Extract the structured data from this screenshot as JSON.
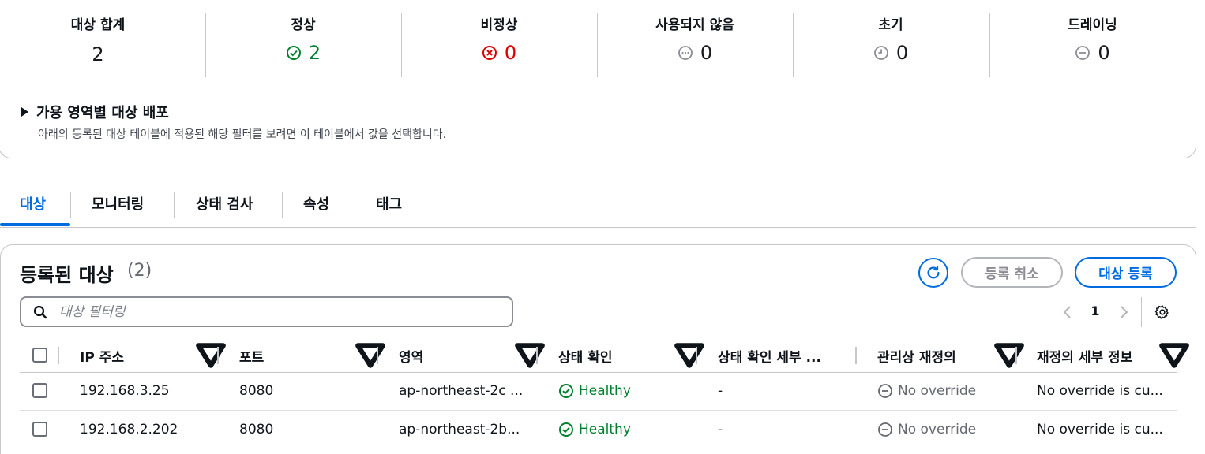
{
  "summary": {
    "stats": [
      {
        "label": "대상 합계",
        "value": "2"
      },
      {
        "label": "정상",
        "value": "2"
      },
      {
        "label": "비정상",
        "value": "0"
      },
      {
        "label": "사용되지 않음",
        "value": "0"
      },
      {
        "label": "초기",
        "value": "0"
      },
      {
        "label": "드레이닝",
        "value": "0"
      }
    ],
    "az_title": "가용 영역별 대상 배포",
    "az_description": "아래의 등록된 대상 테이블에 적용된 해당 필터를 보려면 이 테이블에서 값을 선택합니다."
  },
  "tabs": [
    "대상",
    "모니터링",
    "상태 검사",
    "속성",
    "태그"
  ],
  "targets": {
    "title": "등록된 대상",
    "count": "(2)",
    "deregister_label": "등록 취소",
    "register_label": "대상 등록",
    "search_placeholder": "대상 필터링",
    "page": "1",
    "columns": [
      "IP 주소",
      "포트",
      "영역",
      "상태 확인",
      "상태 확인 세부 ...",
      "관리상 재정의",
      "재정의 세부 정보"
    ],
    "rows": [
      {
        "ip": "192.168.3.25",
        "port": "8080",
        "zone": "ap-northeast-2c ...",
        "health": "Healthy",
        "health_detail": "-",
        "override": "No override",
        "override_detail": "No override is cu..."
      },
      {
        "ip": "192.168.2.202",
        "port": "8080",
        "zone": "ap-northeast-2b...",
        "health": "Healthy",
        "health_detail": "-",
        "override": "No override",
        "override_detail": "No override is cu..."
      }
    ]
  },
  "colors": {
    "accent": "#006ce0",
    "healthy": "#00802f",
    "unhealthy": "#db0000",
    "muted": "#8c8c94"
  }
}
